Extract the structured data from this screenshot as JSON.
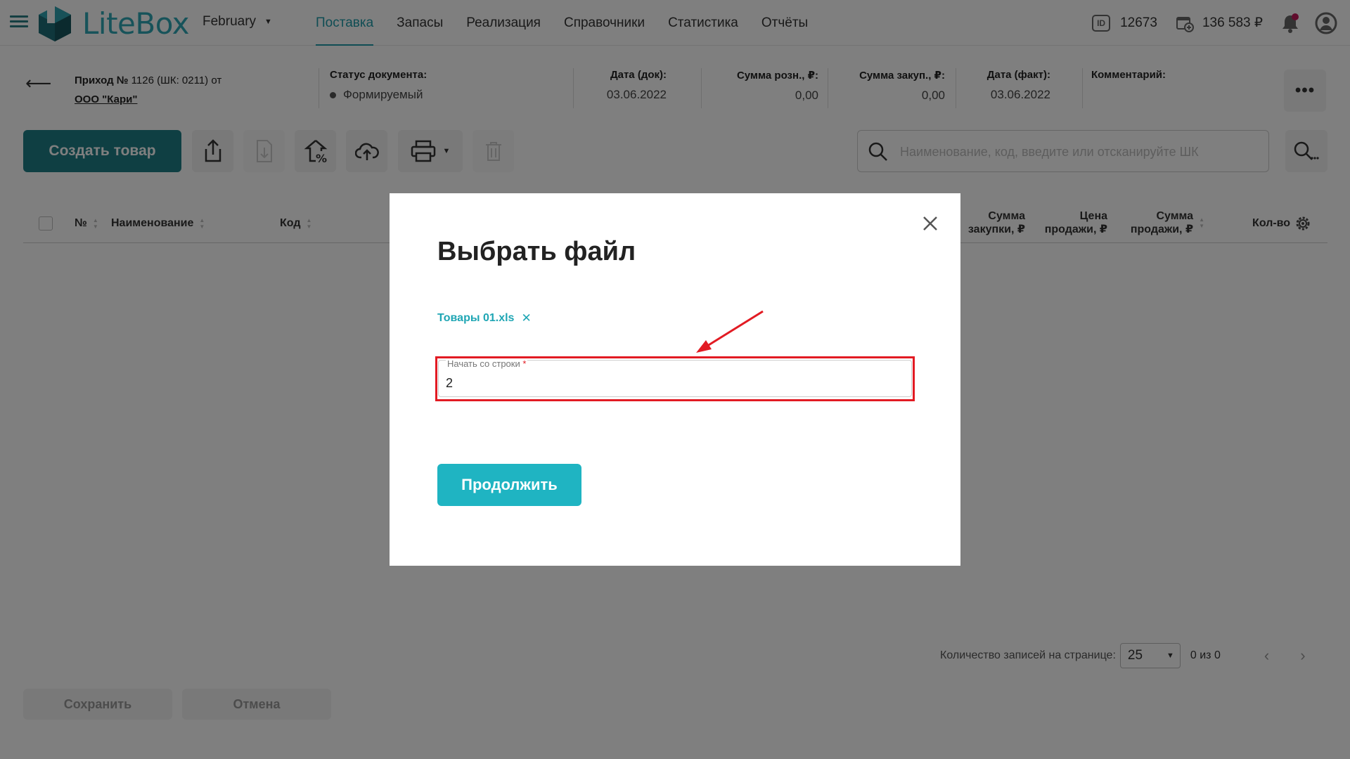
{
  "app": {
    "logo_text": "LiteBox",
    "month": "February"
  },
  "nav": {
    "items": [
      "Поставка",
      "Запасы",
      "Реализация",
      "Справочники",
      "Статистика",
      "Отчёты"
    ],
    "active_index": 0
  },
  "account": {
    "id_badge": "ID",
    "id_value": "12673",
    "balance": "136 583 ₽"
  },
  "document": {
    "title_prefix": "Приход №",
    "title_rest": " 1126 (ШК: 0211) от",
    "supplier": "ООО \"Кари\"",
    "status_label": "Статус документа:",
    "status_value": "Формируемый",
    "date_doc_label": "Дата (док):",
    "date_doc_value": "03.06.2022",
    "retail_sum_label": "Сумма розн., ₽:",
    "retail_sum_value": "0,00",
    "purchase_sum_label": "Сумма закуп., ₽:",
    "purchase_sum_value": "0,00",
    "date_fact_label": "Дата (факт):",
    "date_fact_value": "03.06.2022",
    "comment_label": "Комментарий:"
  },
  "toolbar": {
    "create_label": "Создать товар",
    "search_placeholder": "Наименование, код, введите или отсканируйте ШК"
  },
  "table": {
    "col_num": "№",
    "col_name": "Наименование",
    "col_code": "Код",
    "col_purchase_sum_1": "Сумма",
    "col_purchase_sum_2": "закупки, ₽",
    "col_sale_price_1": "Цена",
    "col_sale_price_2": "продажи, ₽",
    "col_sale_sum_1": "Сумма",
    "col_sale_sum_2": "продажи, ₽",
    "col_qty": "Кол-во"
  },
  "pagination": {
    "label": "Количество записей на странице:",
    "per_page": "25",
    "count": "0 из 0"
  },
  "footer": {
    "save_label": "Сохранить",
    "cancel_label": "Отмена"
  },
  "modal": {
    "title": "Выбрать файл",
    "file_name": "Товары 01.xls",
    "field_label": "Начать со строки",
    "field_required": "*",
    "field_value": "2",
    "continue_label": "Продолжить"
  },
  "colors": {
    "accent": "#1fa6b4",
    "create_button": "#1f7f86",
    "highlight": "#e21b23"
  }
}
